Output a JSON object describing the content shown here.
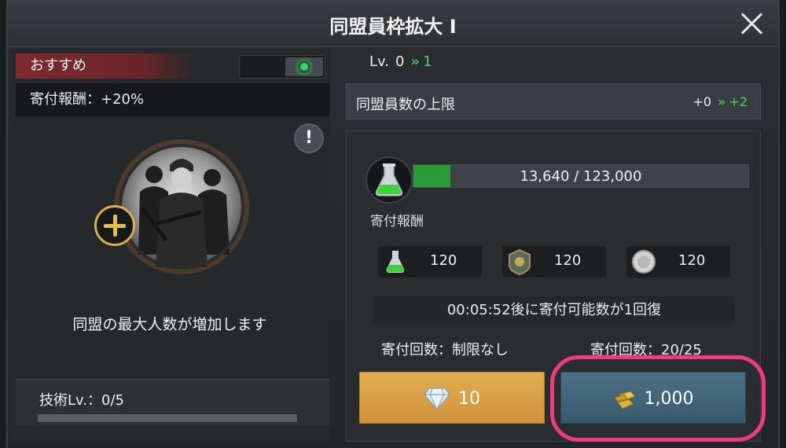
{
  "window": {
    "title": "同盟員枠拡大 I"
  },
  "left": {
    "recommend_label": "おすすめ",
    "reward_bonus": "寄付報酬：+20%",
    "info_symbol": "!",
    "description": "同盟の最大人数が増加します",
    "tech_level": "技術Lv.：0/5"
  },
  "level": {
    "label": "Lv.",
    "current": "0",
    "next": "1",
    "arrow": "»"
  },
  "limit": {
    "label": "同盟員数の上限",
    "current": "+0",
    "next": "+2",
    "arrow": "»"
  },
  "resource": {
    "progress_text": "13,640 / 123,000",
    "progress_fraction": 0.111
  },
  "rewards": {
    "title": "寄付報酬",
    "items": [
      {
        "icon": "flask-icon",
        "amount": "120"
      },
      {
        "icon": "badge-icon",
        "amount": "120"
      },
      {
        "icon": "coin-icon",
        "amount": "120"
      }
    ]
  },
  "cooldown": {
    "text": "00:05:52後に寄付可能数が1回復"
  },
  "counts": {
    "left": "寄付回数：制限なし",
    "right": "寄付回数：20/25"
  },
  "buttons": {
    "diamond_cost": "10",
    "gold_cost": "1,000"
  },
  "colors": {
    "accent_green": "#4bd16a",
    "highlight": "#ee3d78",
    "recommend": "#7d2a2e"
  }
}
